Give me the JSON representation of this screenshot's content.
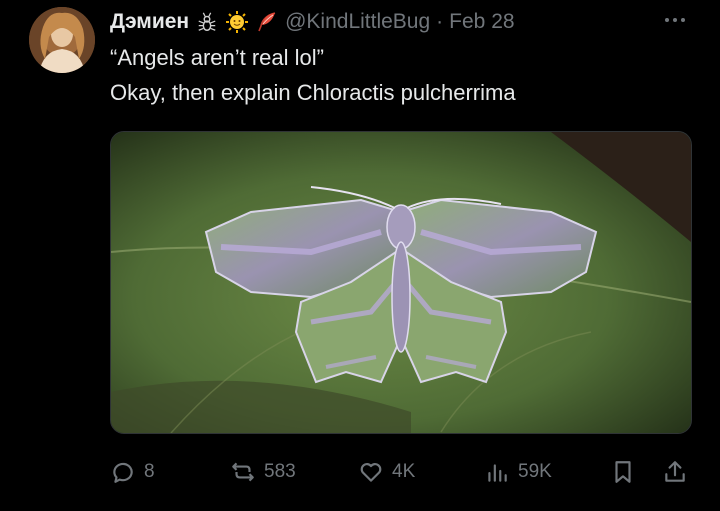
{
  "tweet": {
    "display_name": "Дэмиен",
    "handle": "@KindLittleBug",
    "separator": "·",
    "date": "Feb 28",
    "badge_icons": [
      "bug-icon",
      "sun-icon",
      "feather-icon"
    ],
    "text_line_1": "“Angels aren’t real lol”",
    "text_line_2": "Okay, then explain Chloractis pulcherrima",
    "media": {
      "icon": "moth-photo",
      "subject": "green and lavender moth resting on a leaf"
    }
  },
  "actions": {
    "replies": "8",
    "reposts": "583",
    "likes": "4K",
    "views": "59K"
  },
  "colors": {
    "background": "#000000",
    "text": "#e7e9ea",
    "muted": "#71767b"
  }
}
